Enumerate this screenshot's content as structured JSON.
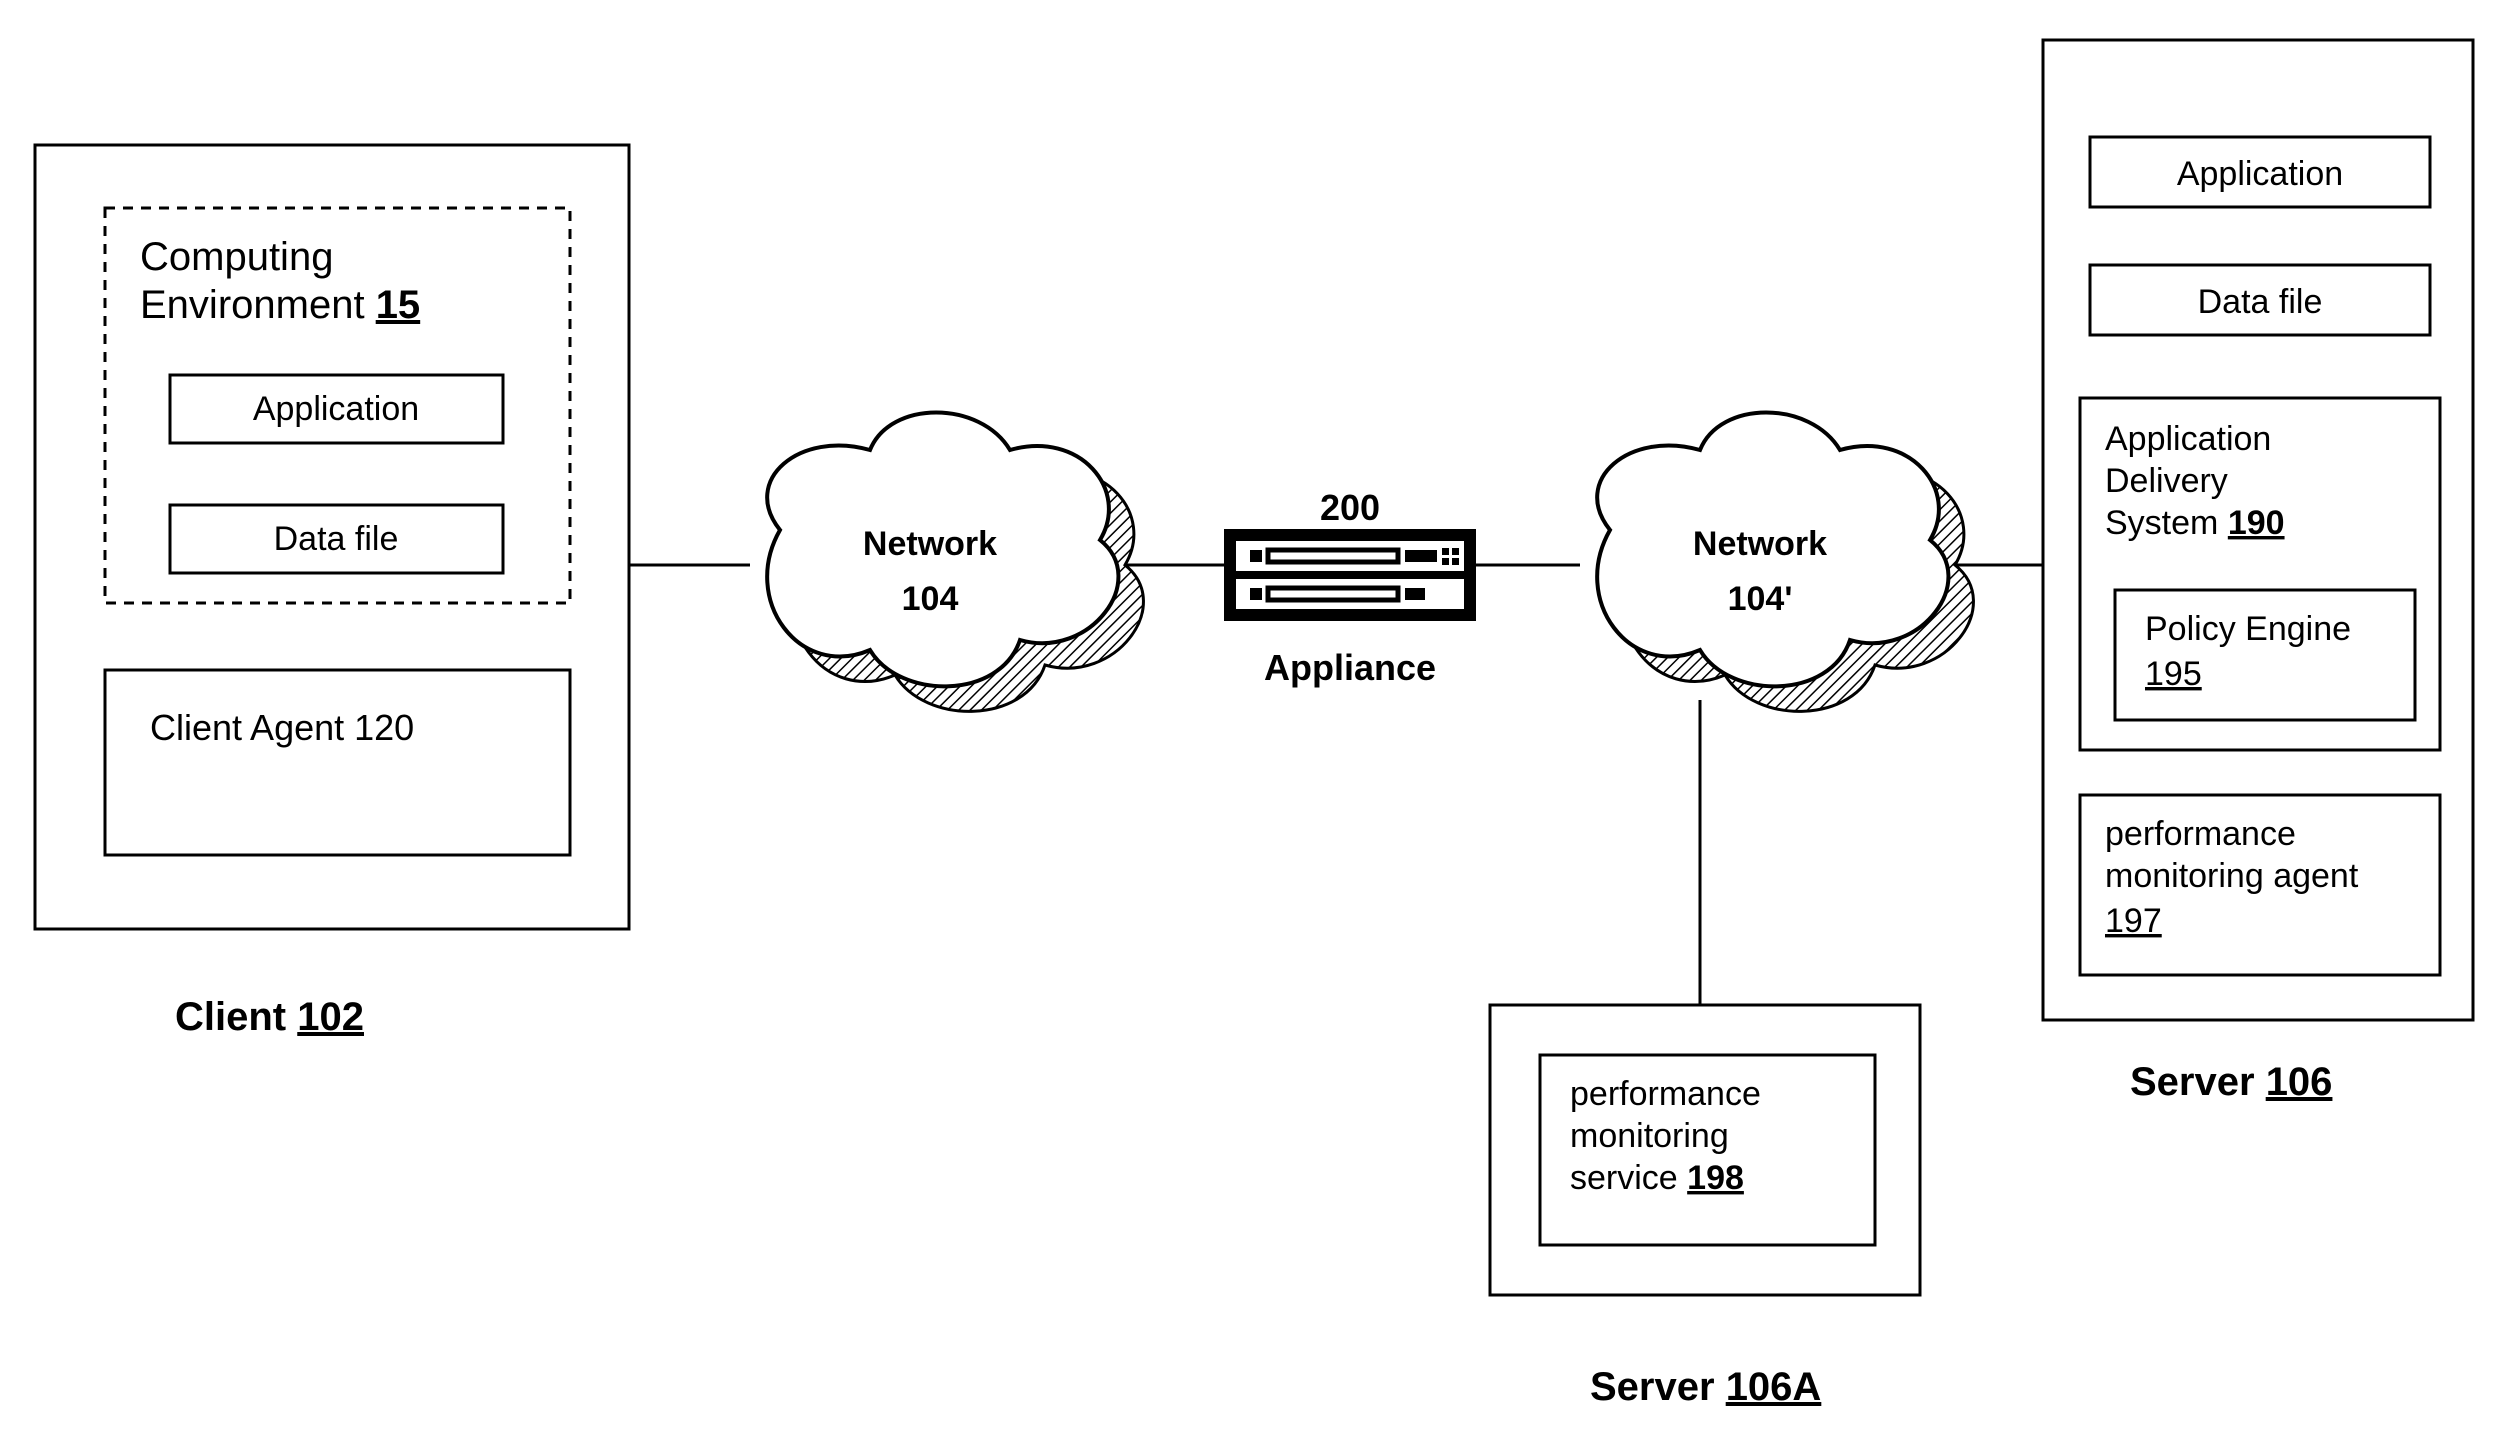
{
  "client": {
    "label": "Client",
    "ref": "102",
    "computing_env": {
      "title_line1": "Computing",
      "title_line2": "Environment",
      "ref": "15",
      "application": "Application",
      "data_file": "Data file"
    },
    "client_agent": "Client Agent 120"
  },
  "network1": {
    "line1": "Network",
    "line2": "104"
  },
  "appliance": {
    "ref": "200",
    "label": "Appliance"
  },
  "network2": {
    "line1": "Network",
    "line2": "104'"
  },
  "server_main": {
    "label": "Server",
    "ref": "106",
    "application": "Application",
    "data_file": "Data file",
    "ads": {
      "line1": "Application",
      "line2": "Delivery",
      "line3_prefix": "System",
      "line3_ref": "190",
      "policy_engine": "Policy Engine",
      "policy_engine_ref": "195"
    },
    "perf_monitor": {
      "line1": "performance",
      "line2": "monitoring agent",
      "ref": "197"
    }
  },
  "server_bottom": {
    "label": "Server",
    "ref": "106A",
    "pms": {
      "line1": "performance",
      "line2": "monitoring",
      "line3_prefix": "service",
      "line3_ref": "198"
    }
  }
}
